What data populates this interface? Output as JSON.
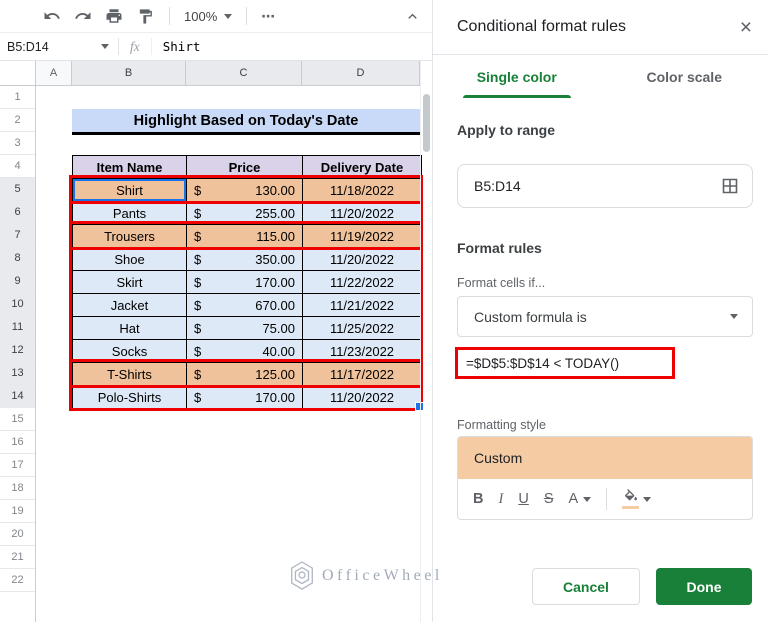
{
  "toolbar": {
    "zoom_label": "100%",
    "more_label": "⋯"
  },
  "formula_bar": {
    "name_box": "B5:D14",
    "fx_label": "fx",
    "content": "Shirt"
  },
  "grid": {
    "column_headers": [
      "A",
      "B",
      "C",
      "D"
    ],
    "selected_columns": [
      "B",
      "C",
      "D"
    ],
    "row_numbers": [
      1,
      2,
      3,
      4,
      5,
      6,
      7,
      8,
      9,
      10,
      11,
      12,
      13,
      14,
      15,
      16,
      17,
      18,
      19,
      20,
      21,
      22
    ],
    "selected_rows": {
      "from": 5,
      "to": 14
    },
    "active_cell": "B5"
  },
  "sheet_table": {
    "title": "Highlight Based on Today's Date",
    "headers": [
      "Item Name",
      "Price",
      "Delivery Date"
    ],
    "currency_symbol": "$",
    "rows": [
      {
        "item": "Shirt",
        "price": "130.00",
        "date": "11/18/2022",
        "highlighted": true
      },
      {
        "item": "Pants",
        "price": "255.00",
        "date": "11/20/2022",
        "highlighted": false
      },
      {
        "item": "Trousers",
        "price": "115.00",
        "date": "11/19/2022",
        "highlighted": true
      },
      {
        "item": "Shoe",
        "price": "350.00",
        "date": "11/20/2022",
        "highlighted": false
      },
      {
        "item": "Skirt",
        "price": "170.00",
        "date": "11/22/2022",
        "highlighted": false
      },
      {
        "item": "Jacket",
        "price": "670.00",
        "date": "11/21/2022",
        "highlighted": false
      },
      {
        "item": "Hat",
        "price": "75.00",
        "date": "11/25/2022",
        "highlighted": false
      },
      {
        "item": "Socks",
        "price": "40.00",
        "date": "11/23/2022",
        "highlighted": false
      },
      {
        "item": "T-Shirts",
        "price": "125.00",
        "date": "11/17/2022",
        "highlighted": true
      },
      {
        "item": "Polo-Shirts",
        "price": "170.00",
        "date": "11/20/2022",
        "highlighted": false
      }
    ]
  },
  "watermark": {
    "text": "OfficeWheel"
  },
  "panel": {
    "title": "Conditional format rules",
    "close_label": "×",
    "tabs": [
      {
        "label": "Single color",
        "active": true
      },
      {
        "label": "Color scale",
        "active": false
      }
    ],
    "apply_to_range": {
      "label": "Apply to range",
      "value": "B5:D14"
    },
    "format_rules": {
      "heading": "Format rules",
      "condition_label": "Format cells if...",
      "condition_value": "Custom formula is",
      "formula": "=$D$5:$D$14 < TODAY()"
    },
    "formatting_style": {
      "label": "Formatting style",
      "preview_text": "Custom",
      "buttons": {
        "bold": "B",
        "italic": "I",
        "underline": "U",
        "strikethrough": "S",
        "text_color": "A"
      }
    },
    "buttons": {
      "cancel": "Cancel",
      "done": "Done"
    }
  },
  "colors": {
    "hl_orange": "#F0C29B",
    "preview_orange": "#F5CBA3",
    "row_blue": "#DDE9F6",
    "hdr_lavender": "#D9D2E9",
    "title_blue": "#C9DAF8",
    "accent_green": "#188038",
    "annotation_red": "#EE0000",
    "sel_blue": "#1A73E8"
  }
}
